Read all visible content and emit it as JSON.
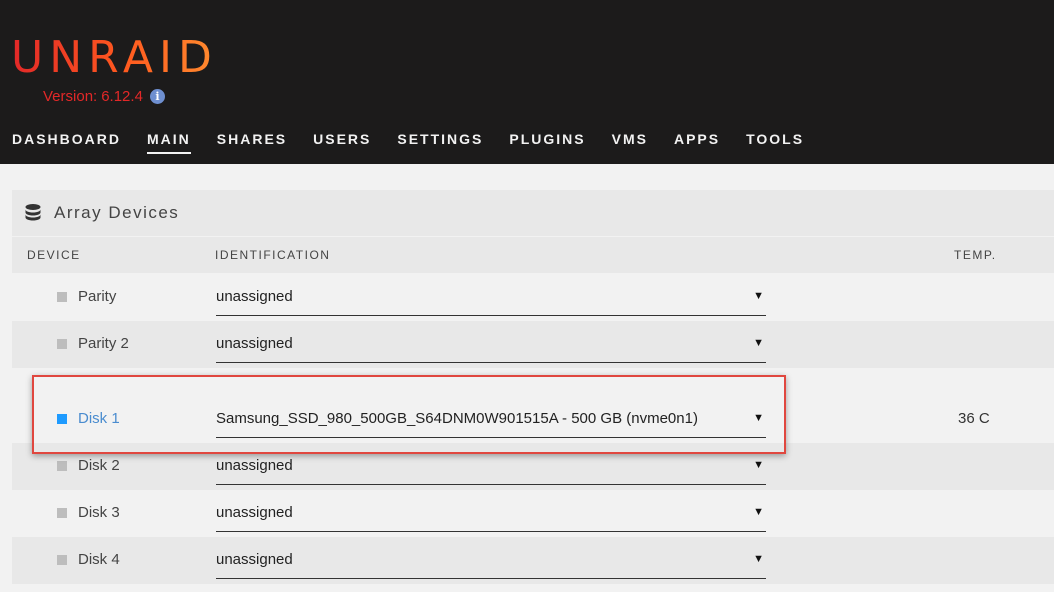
{
  "app": {
    "logo_text": "UNRAID",
    "version_label": "Version:",
    "version_number": "6.12.4",
    "info_icon": "info-icon"
  },
  "nav": {
    "items": [
      {
        "label": "DASHBOARD",
        "active": false
      },
      {
        "label": "MAIN",
        "active": true
      },
      {
        "label": "SHARES",
        "active": false
      },
      {
        "label": "USERS",
        "active": false
      },
      {
        "label": "SETTINGS",
        "active": false
      },
      {
        "label": "PLUGINS",
        "active": false
      },
      {
        "label": "VMS",
        "active": false
      },
      {
        "label": "APPS",
        "active": false
      },
      {
        "label": "TOOLS",
        "active": false
      }
    ]
  },
  "panel": {
    "title": "Array Devices",
    "icon": "database-icon",
    "columns": {
      "device": "DEVICE",
      "identification": "IDENTIFICATION",
      "temp": "TEMP."
    },
    "rows": [
      {
        "device": "Parity",
        "identification": "unassigned",
        "temp": "",
        "status": "inactive"
      },
      {
        "device": "Parity 2",
        "identification": "unassigned",
        "temp": "",
        "status": "inactive"
      },
      {
        "device": "Disk 1",
        "identification": "Samsung_SSD_980_500GB_S64DNM0W901515A - 500 GB (nvme0n1)",
        "temp": "36 C",
        "status": "active"
      },
      {
        "device": "Disk 2",
        "identification": "unassigned",
        "temp": "",
        "status": "inactive"
      },
      {
        "device": "Disk 3",
        "identification": "unassigned",
        "temp": "",
        "status": "inactive"
      },
      {
        "device": "Disk 4",
        "identification": "unassigned",
        "temp": "",
        "status": "inactive"
      }
    ]
  },
  "colors": {
    "header_bg": "#1c1b1b",
    "brand_red": "#e22828",
    "brand_orange": "#ff8c2f",
    "active_status": "#1e9bff",
    "inactive_status": "#bdbdbd",
    "highlight": "#e0473f"
  }
}
